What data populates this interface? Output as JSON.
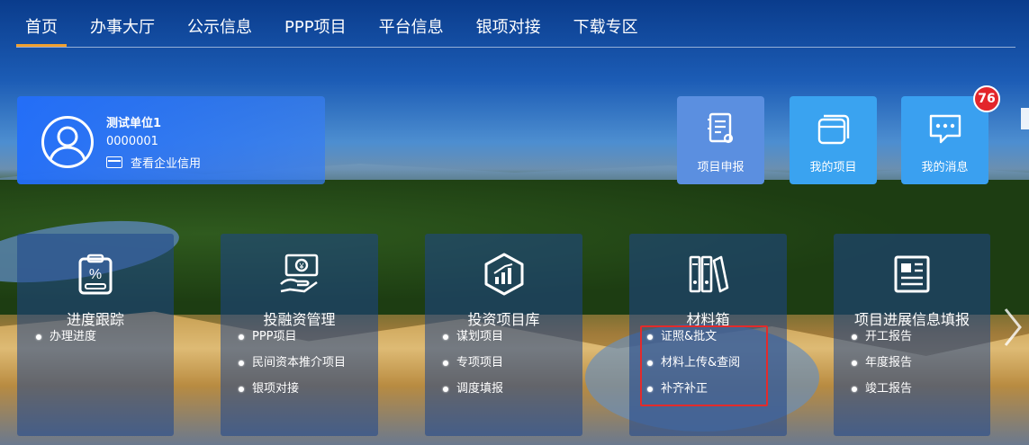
{
  "nav": {
    "items": [
      "首页",
      "办事大厅",
      "公示信息",
      "PPP项目",
      "平台信息",
      "银项对接",
      "下载专区"
    ],
    "active_index": 0
  },
  "user": {
    "name": "测试单位1",
    "code": "0000001",
    "credit_link": "查看企业信用"
  },
  "tiles": [
    {
      "label": "项目申报",
      "icon": "document-edit-icon"
    },
    {
      "label": "我的项目",
      "icon": "stacked-cards-icon"
    },
    {
      "label": "我的消息",
      "icon": "chat-bubble-icon",
      "badge": "76"
    }
  ],
  "columns": [
    {
      "title": "进度跟踪",
      "icon": "percent-clipboard-icon",
      "items": [
        "办理进度"
      ]
    },
    {
      "title": "投融资管理",
      "icon": "money-hand-icon",
      "items": [
        "PPP项目",
        "民间资本推介项目",
        "银项对接"
      ]
    },
    {
      "title": "投资项目库",
      "icon": "chart-cube-icon",
      "items": [
        "谋划项目",
        "专项项目",
        "调度填报"
      ]
    },
    {
      "title": "材料箱",
      "icon": "binders-icon",
      "items": [
        "证照&批文",
        "材料上传&查阅",
        "补齐补正"
      ]
    },
    {
      "title": "项目进展信息填报",
      "icon": "newspaper-icon",
      "items": [
        "开工报告",
        "年度报告",
        "竣工报告"
      ]
    }
  ],
  "colors": {
    "nav_active_underline": "#f0a030",
    "badge": "#e3262b",
    "highlight_border": "#e32b2b"
  }
}
